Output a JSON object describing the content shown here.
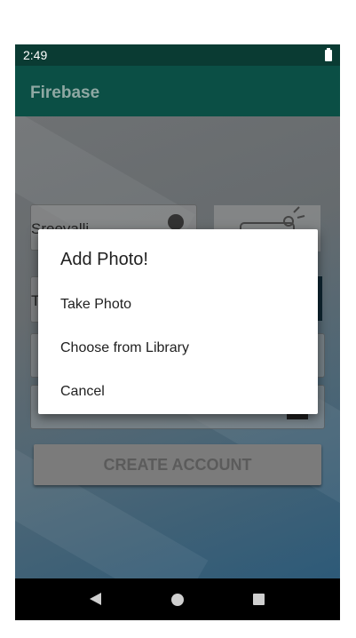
{
  "status_bar": {
    "time": "2:49"
  },
  "app_bar": {
    "title": "Firebase"
  },
  "form": {
    "name_value": "Sreevalli",
    "field2_value": "T",
    "create_button": "CREATE ACCOUNT"
  },
  "dialog": {
    "title": "Add Photo!",
    "options": [
      "Take Photo",
      "Choose from Library",
      "Cancel"
    ]
  },
  "colors": {
    "status_bar": "#0a3b33",
    "app_bar": "#0b4f45",
    "dialog_bg": "#ffffff"
  }
}
